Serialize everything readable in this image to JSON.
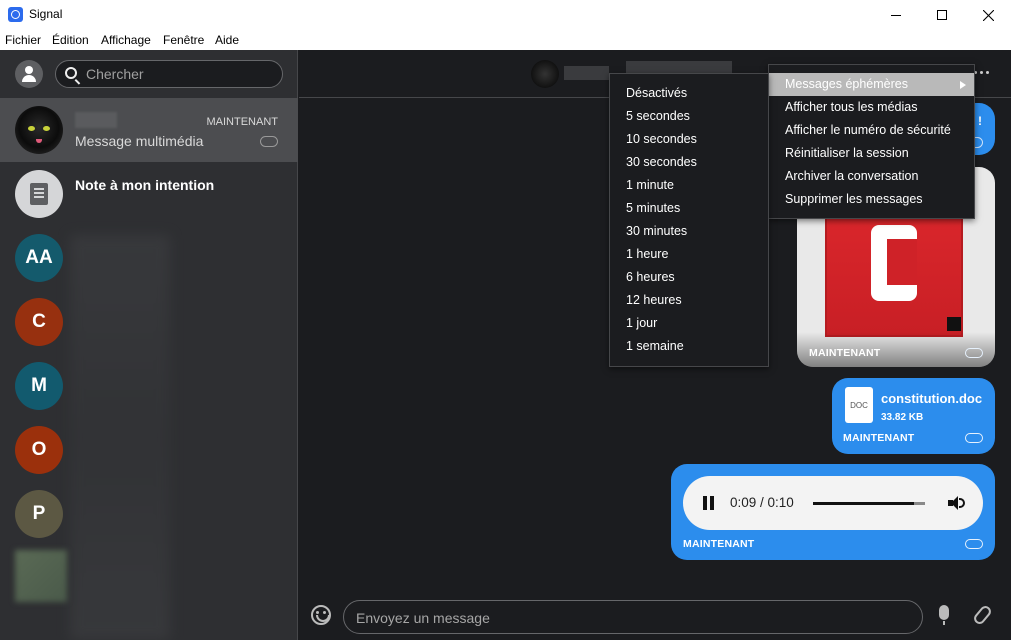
{
  "window": {
    "title": "Signal"
  },
  "menubar": [
    "Fichier",
    "Édition",
    "Affichage",
    "Fenêtre",
    "Aide"
  ],
  "sidebar": {
    "search": {
      "placeholder": "Chercher"
    },
    "conversations": [
      {
        "time": "MAINTENANT",
        "preview": "Message multimédia"
      },
      {
        "title": "Note à mon intention"
      },
      {
        "initials": "AA",
        "color": "#145a6c"
      },
      {
        "initials": "C",
        "color": "#97300f"
      },
      {
        "initials": "M",
        "color": "#125a6e"
      },
      {
        "initials": "O",
        "color": "#9b300c"
      },
      {
        "initials": "P",
        "color": "#5c5843"
      }
    ]
  },
  "chat": {
    "top_bubble_symbol": "!",
    "image_message": {
      "time": "MAINTENANT"
    },
    "doc_message": {
      "icon_label": "DOC",
      "filename": "constitution.doc",
      "size": "33.82 KB",
      "time": "MAINTENANT"
    },
    "audio_message": {
      "time_display": "0:09 / 0:10",
      "progress": 0.9,
      "time": "MAINTENANT"
    },
    "composer": {
      "placeholder": "Envoyez un message"
    }
  },
  "context_menu": {
    "items": [
      "Messages éphémères",
      "Afficher tous les médias",
      "Afficher le numéro de sécurité",
      "Réinitialiser la session",
      "Archiver la conversation",
      "Supprimer les messages"
    ],
    "highlighted_index": 0
  },
  "disappearing_submenu": {
    "items": [
      "Désactivés",
      "5 secondes",
      "10 secondes",
      "30 secondes",
      "1 minute",
      "5 minutes",
      "30 minutes",
      "1 heure",
      "6 heures",
      "12 heures",
      "1 jour",
      "1 semaine"
    ]
  },
  "colors": {
    "accent": "#2c8ded",
    "sidebar_bg": "#2e2f32",
    "chat_bg": "#1b1c1f"
  }
}
